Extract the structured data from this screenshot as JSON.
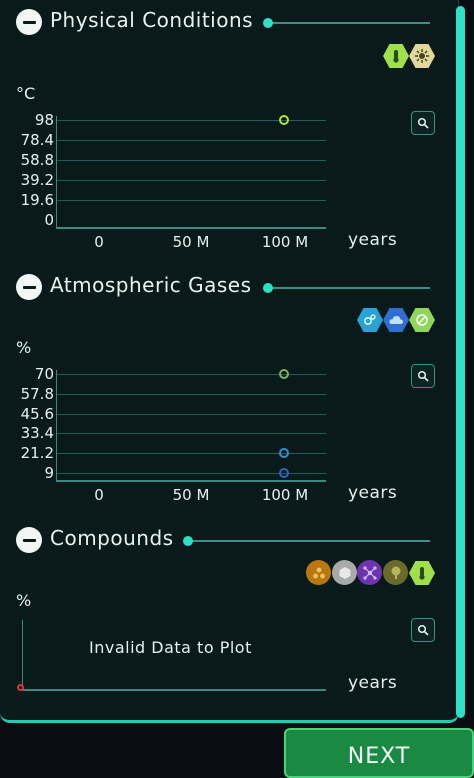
{
  "sections": [
    {
      "title": "Physical Conditions",
      "unit": "°C",
      "y_ticks": [
        "98",
        "78.4",
        "58.8",
        "39.2",
        "19.6",
        "0"
      ],
      "x_ticks": [
        "0",
        "50 M",
        "100 M"
      ],
      "x_unit": "years",
      "icons": [
        "thermometer-icon",
        "sun-icon"
      ],
      "colors": {
        "point": "#b6e03c"
      }
    },
    {
      "title": "Atmospheric Gases",
      "unit": "%",
      "y_ticks": [
        "70",
        "57.8",
        "45.6",
        "33.4",
        "21.2",
        "9"
      ],
      "x_ticks": [
        "0",
        "50 M",
        "100 M"
      ],
      "x_unit": "years",
      "icons": [
        "oxygen-icon",
        "cloud-icon",
        "no-entry-icon"
      ]
    },
    {
      "title": "Compounds",
      "unit": "%",
      "x_unit": "years",
      "message": "Invalid Data to Plot",
      "icons": [
        "molecule-icon",
        "hexagon-icon",
        "network-icon",
        "tree-icon",
        "thermometer-icon"
      ]
    }
  ],
  "chart_data": [
    {
      "type": "scatter",
      "ylabel": "°C",
      "xlabel": "years",
      "ylim": [
        0,
        98
      ],
      "xlim": [
        0,
        100000000
      ],
      "series": [
        {
          "x": [
            100000000
          ],
          "y": [
            98
          ],
          "color": "#b6e03c"
        }
      ]
    },
    {
      "type": "scatter",
      "ylabel": "%",
      "xlabel": "years",
      "ylim": [
        9,
        70
      ],
      "xlim": [
        0,
        100000000
      ],
      "series": [
        {
          "x": [
            100000000
          ],
          "y": [
            70
          ],
          "color": "#7fb05a"
        },
        {
          "x": [
            100000000
          ],
          "y": [
            21.2
          ],
          "color": "#2f8fd6"
        },
        {
          "x": [
            100000000
          ],
          "y": [
            9
          ],
          "color": "#2a65c4"
        }
      ]
    }
  ],
  "footer": {
    "next_label": "NEXT"
  }
}
